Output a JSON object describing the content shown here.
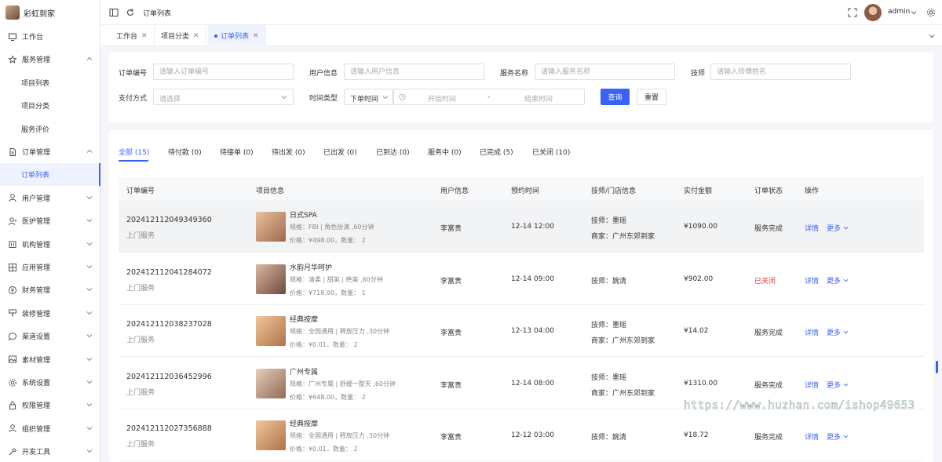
{
  "app": {
    "name": "彩虹到家"
  },
  "sidebar": {
    "items": [
      {
        "label": "工作台",
        "icon": "monitor-icon",
        "has_children": false
      },
      {
        "label": "服务管理",
        "icon": "star-icon",
        "has_children": true,
        "expanded": true
      },
      {
        "label": "项目列表",
        "sub": true
      },
      {
        "label": "项目分类",
        "sub": true
      },
      {
        "label": "服务评价",
        "sub": true
      },
      {
        "label": "订单管理",
        "icon": "file-icon",
        "has_children": true,
        "expanded": true
      },
      {
        "label": "订单列表",
        "sub": true,
        "active": true
      },
      {
        "label": "用户管理",
        "icon": "user-icon",
        "has_children": true
      },
      {
        "label": "医护管理",
        "icon": "user-check-icon",
        "has_children": true
      },
      {
        "label": "机构管理",
        "icon": "bank-icon",
        "has_children": true
      },
      {
        "label": "应用管理",
        "icon": "grid-icon",
        "has_children": true
      },
      {
        "label": "财务管理",
        "icon": "coin-icon",
        "has_children": true
      },
      {
        "label": "装修管理",
        "icon": "brush-icon",
        "has_children": true
      },
      {
        "label": "渠道设置",
        "icon": "chat-icon",
        "has_children": true
      },
      {
        "label": "素材管理",
        "icon": "image-icon",
        "has_children": true
      },
      {
        "label": "系统设置",
        "icon": "gear-icon",
        "has_children": true
      },
      {
        "label": "权限管理",
        "icon": "lock-icon",
        "has_children": true
      },
      {
        "label": "组织管理",
        "icon": "user-icon",
        "has_children": true
      },
      {
        "label": "开发工具",
        "icon": "tool-icon",
        "has_children": true
      }
    ]
  },
  "header": {
    "breadcrumb": "订单列表",
    "username": "admin"
  },
  "page_tabs": [
    {
      "label": "工作台",
      "active": false
    },
    {
      "label": "项目分类",
      "active": false
    },
    {
      "label": "订单列表",
      "active": true
    }
  ],
  "filters": {
    "order_no": {
      "label": "订单编号",
      "placeholder": "请输入订单编号"
    },
    "user_info": {
      "label": "用户信息",
      "placeholder": "请输入用户信息"
    },
    "service_name": {
      "label": "服务名称",
      "placeholder": "请输入服务名称"
    },
    "technician": {
      "label": "技师",
      "placeholder": "请输入师傅姓名"
    },
    "pay_method": {
      "label": "支付方式",
      "placeholder": "请选择"
    },
    "time_type": {
      "label": "时间类型",
      "value": "下单时间",
      "start_placeholder": "开始时间",
      "range_sep": "-",
      "end_placeholder": "结束时间"
    },
    "search_label": "查询",
    "reset_label": "重置"
  },
  "status_tabs": [
    {
      "label": "全部 (15)",
      "active": true
    },
    {
      "label": "待付款 (0)"
    },
    {
      "label": "待接单 (0)"
    },
    {
      "label": "待出发 (0)"
    },
    {
      "label": "已出发 (0)"
    },
    {
      "label": "已到达 (0)"
    },
    {
      "label": "服务中 (0)"
    },
    {
      "label": "已完成 (5)"
    },
    {
      "label": "已关闭 (10)"
    }
  ],
  "table": {
    "columns": [
      "订单编号",
      "项目信息",
      "用户信息",
      "预约时间",
      "技师/门店信息",
      "实付金额",
      "订单状态",
      "操作"
    ],
    "rows": [
      {
        "order_no": "202412112049349360",
        "type": "上门服务",
        "title": "日式SPA",
        "spec": "规格：FBI | 角色扮演 ,60分钟",
        "price": "价格：¥498.00，数量： 2",
        "user": "李富贵",
        "time": "12-14 12:00",
        "tech": "技师：墨瑶",
        "store": "商家：广州东郊到家",
        "amount": "¥1090.00",
        "status": "服务完成",
        "status_color": "#333333",
        "detail": "详情",
        "more": "更多",
        "thumb": [
          "#e8c3a0",
          "#a0674a"
        ]
      },
      {
        "order_no": "202412112041284072",
        "type": "上门服务",
        "title": "水韵月华呵护",
        "spec": "规格：清柔 | 甜美 | 绝美 ,60分钟",
        "price": "价格：¥718.00，数量： 1",
        "user": "李富贵",
        "time": "12-14 09:00",
        "tech": "技师：婉清",
        "store": "",
        "amount": "¥902.00",
        "status": "已关闭",
        "status_color": "#e23c3c",
        "detail": "详情",
        "more": "更多",
        "thumb": [
          "#d9b7a0",
          "#6e4a3c"
        ]
      },
      {
        "order_no": "202412112038237028",
        "type": "上门服务",
        "title": "经典按摩",
        "spec": "规格：全国通用 | 释放压力 ,30分钟",
        "price": "价格：¥0.01，数量： 2",
        "user": "李富贵",
        "time": "12-13 04:00",
        "tech": "技师：墨瑶",
        "store": "商家：广州东郊到家",
        "amount": "¥14.02",
        "status": "服务完成",
        "status_color": "#333333",
        "detail": "详情",
        "more": "更多",
        "thumb": [
          "#f0c79a",
          "#b07248"
        ]
      },
      {
        "order_no": "202412112036452996",
        "type": "上门服务",
        "title": "广州专属",
        "spec": "规格：广州专属 | 舒缓一整天 ,60分钟",
        "price": "价格：¥648.00，数量： 2",
        "user": "李富贵",
        "time": "12-14 08:00",
        "tech": "技师：墨瑶",
        "store": "商家：广州东郊到家",
        "amount": "¥1310.00",
        "status": "服务完成",
        "status_color": "#333333",
        "detail": "详情",
        "more": "更多",
        "thumb": [
          "#e9cfb8",
          "#8e6a55"
        ]
      },
      {
        "order_no": "202412112027356888",
        "type": "上门服务",
        "title": "经典按摩",
        "spec": "规格：全国通用 | 释放压力 ,30分钟",
        "price": "价格：¥0.01，数量： 2",
        "user": "李富贵",
        "time": "12-12 03:00",
        "tech": "技师：婉清",
        "store": "",
        "amount": "¥18.72",
        "status": "服务完成",
        "status_color": "#333333",
        "detail": "详情",
        "more": "更多",
        "thumb": [
          "#f0c79a",
          "#b07248"
        ]
      }
    ]
  },
  "watermark": "https://www.huzhan.com/ishop49653",
  "colors": {
    "accent": "#3b62f6",
    "danger": "#e23c3c"
  }
}
